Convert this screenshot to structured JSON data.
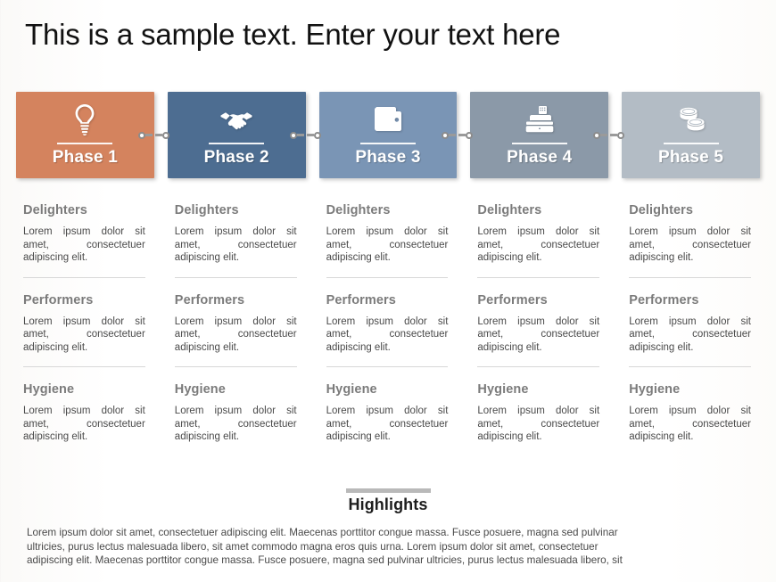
{
  "slide": {
    "title": "This is a sample text. Enter your text here",
    "background_color": "#ffffff"
  },
  "phases": [
    {
      "label": "Phase 1",
      "icon": "lightbulb-icon",
      "color": "#d4835e"
    },
    {
      "label": "Phase 2",
      "icon": "handshake-icon",
      "color": "#4d6d91"
    },
    {
      "label": "Phase 3",
      "icon": "wallet-icon",
      "color": "#7a95b5"
    },
    {
      "label": "Phase 4",
      "icon": "cash-register-icon",
      "color": "#8b99a8"
    },
    {
      "label": "Phase 5",
      "icon": "coins-icon",
      "color": "#b3bcc5"
    }
  ],
  "sections": [
    {
      "heading": "Delighters",
      "body": "Lorem ipsum dolor sit amet, consectetuer adipiscing elit."
    },
    {
      "heading": "Performers",
      "body": "Lorem ipsum dolor sit amet, consectetuer adipiscing elit."
    },
    {
      "heading": "Hygiene",
      "body": "Lorem ipsum dolor sit amet, consectetuer adipiscing elit."
    }
  ],
  "columns": [
    {
      "delighters_heading": "Delighters",
      "delighters_body": "Lorem ipsum dolor sit amet, consectetuer adipiscing elit.",
      "performers_heading": "Performers",
      "performers_body": "Lorem ipsum dolor sit amet, consectetuer adipiscing elit.",
      "hygiene_heading": "Hygiene",
      "hygiene_body": "Lorem ipsum dolor sit amet, consectetuer adipiscing elit."
    },
    {
      "delighters_heading": "Delighters",
      "delighters_body": "Lorem ipsum dolor sit amet, consectetuer adipiscing elit.",
      "performers_heading": "Performers",
      "performers_body": "Lorem ipsum dolor sit amet, consectetuer adipiscing elit.",
      "hygiene_heading": "Hygiene",
      "hygiene_body": "Lorem ipsum dolor sit amet, consectetuer adipiscing elit."
    },
    {
      "delighters_heading": "Delighters",
      "delighters_body": "Lorem ipsum dolor sit amet, consectetuer adipiscing elit.",
      "performers_heading": "Performers",
      "performers_body": "Lorem ipsum dolor sit amet, consectetuer adipiscing elit.",
      "hygiene_heading": "Hygiene",
      "hygiene_body": "Lorem ipsum dolor sit amet, consectetuer adipiscing elit."
    },
    {
      "delighters_heading": "Delighters",
      "delighters_body": "Lorem ipsum dolor sit amet, consectetuer adipiscing elit.",
      "performers_heading": "Performers",
      "performers_body": "Lorem ipsum dolor sit amet, consectetuer adipiscing elit.",
      "hygiene_heading": "Hygiene",
      "hygiene_body": "Lorem ipsum dolor sit amet, consectetuer adipiscing elit."
    },
    {
      "delighters_heading": "Delighters",
      "delighters_body": "Lorem ipsum dolor sit amet, consectetuer adipiscing elit.",
      "performers_heading": "Performers",
      "performers_body": "Lorem ipsum dolor sit amet, consectetuer adipiscing elit.",
      "hygiene_heading": "Hygiene",
      "hygiene_body": "Lorem ipsum dolor sit amet, consectetuer adipiscing elit."
    }
  ],
  "highlights": {
    "title": "Highlights",
    "line1": "Lorem ipsum dolor sit amet, consectetuer adipiscing elit. Maecenas porttitor congue massa. Fusce posuere, magna sed pulvinar",
    "line2": "ultricies, purus lectus malesuada libero, sit amet commodo magna eros quis urna. Lorem ipsum dolor sit amet, consectetuer",
    "line3": "adipiscing elit. Maecenas porttitor congue massa. Fusce posuere, magna sed pulvinar ultricies, purus lectus malesuada libero, sit"
  }
}
